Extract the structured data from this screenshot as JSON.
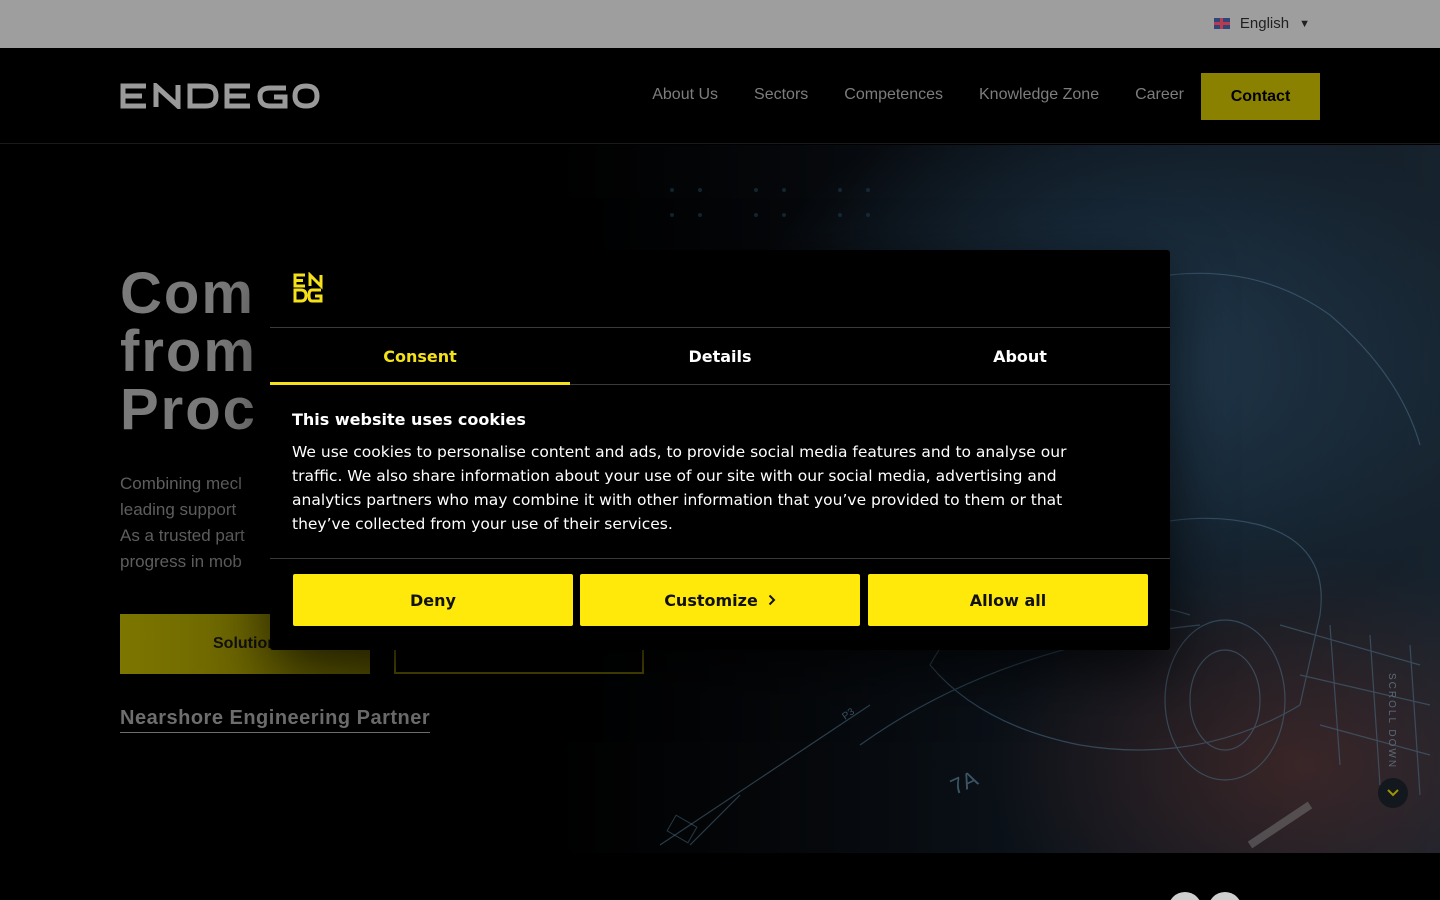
{
  "topbar": {
    "language": "English",
    "flag_icon": "uk-flag-icon",
    "caret_icon": "caret-down-icon"
  },
  "header": {
    "logo_text": "ENDEGO",
    "nav": [
      "About Us",
      "Sectors",
      "Competences",
      "Knowledge Zone",
      "Career"
    ],
    "contact_label": "Contact"
  },
  "hero": {
    "title_lines": [
      "Com",
      "from",
      "Proc"
    ],
    "description_lines": [
      "Combining mecl",
      "leading support",
      "As a trusted part",
      "progress in mob"
    ],
    "primary_button": "Solution",
    "link": "Nearshore Engineering Partner",
    "scroll_label": "SCROLL DOWN",
    "scroll_icon": "chevron-down-icon"
  },
  "dialog": {
    "tabs": [
      {
        "label": "Consent",
        "active": true
      },
      {
        "label": "Details",
        "active": false
      },
      {
        "label": "About",
        "active": false
      }
    ],
    "heading": "This website uses cookies",
    "body": "We use cookies to personalise content and ads, to provide social media features and to analyse our traffic. We also share information about your use of our site with our social media, advertising and analytics partners who may combine it with other information that you’ve provided to them or that they’ve collected from your use of their services.",
    "buttons": {
      "deny": "Deny",
      "customize": "Customize",
      "allow": "Allow all"
    },
    "customize_icon": "chevron-right-icon"
  },
  "colors": {
    "accent": "#ffe90a",
    "accent_dim": "#8a8100",
    "topbar": "#9e9e9e"
  }
}
